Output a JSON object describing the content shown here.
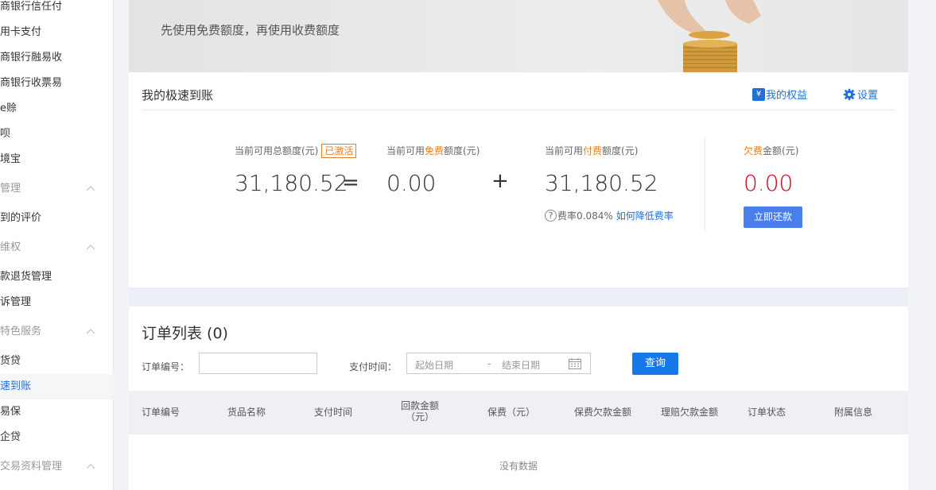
{
  "sidebar": {
    "items": [
      {
        "label": "商银行信任付",
        "type": "item"
      },
      {
        "label": "用卡支付",
        "type": "item"
      },
      {
        "label": "商银行融易收",
        "type": "item"
      },
      {
        "label": "商银行收票易",
        "type": "item"
      },
      {
        "label": "e赊",
        "type": "item"
      },
      {
        "label": "呗",
        "type": "item"
      },
      {
        "label": "境宝",
        "type": "item"
      },
      {
        "label": "管理",
        "type": "group"
      },
      {
        "label": "到的评价",
        "type": "item"
      },
      {
        "label": "维权",
        "type": "group"
      },
      {
        "label": "款退货管理",
        "type": "item"
      },
      {
        "label": "诉管理",
        "type": "item"
      },
      {
        "label": "特色服务",
        "type": "group"
      },
      {
        "label": "货贷",
        "type": "item"
      },
      {
        "label": "速到账",
        "type": "item",
        "active": true
      },
      {
        "label": "易保",
        "type": "item"
      },
      {
        "label": "企贷",
        "type": "item"
      },
      {
        "label": "交易资料管理",
        "type": "group"
      }
    ]
  },
  "banner": {
    "subtitle": "先使用免费额度，再使用收费额度"
  },
  "account": {
    "title": "我的极速到账",
    "benefit_link": "我的权益",
    "benefit_icon": "yen-icon",
    "benefit_icon_glyph": "¥",
    "settings_link": "设置",
    "settings_icon": "gear-icon",
    "total": {
      "label_pre": "当前可用总额度(元)",
      "badge": "已激活",
      "value": "31,180.52",
      "eq": "="
    },
    "free": {
      "label_pre": "当前可用",
      "label_hl": "免费",
      "label_post": "额度(元)",
      "value": "0.00"
    },
    "plus": "+",
    "paid": {
      "label_pre": "当前可用",
      "label_hl": "付费",
      "label_post": "额度(元)",
      "value": "31,180.52"
    },
    "rate": {
      "q": "?",
      "text": "费率0.084%",
      "link": "如何降低费率"
    },
    "debt": {
      "label_hl": "欠费",
      "label_post": "金额(元)",
      "value": "0.00",
      "button": "立即还款"
    }
  },
  "orders": {
    "title": "订单列表 (0)",
    "order_no_label": "订单编号：",
    "pay_time_label": "支付时间：",
    "start_placeholder": "起始日期",
    "sep": "-",
    "end_placeholder": "结束日期",
    "query_button": "查询",
    "columns": [
      [
        "订单编号"
      ],
      [
        "货品名称"
      ],
      [
        "支付时间"
      ],
      [
        "回款金额",
        "（元）"
      ],
      [
        "保费（元）"
      ],
      [
        "保费欠款金额"
      ],
      [
        "理赔欠款金额"
      ],
      [
        "订单状态"
      ],
      [
        "附属信息"
      ]
    ],
    "empty_text": "没有数据"
  },
  "colors": {
    "accent": "#1e6fd9",
    "button": "#1677e8",
    "highlight": "#e67e22",
    "danger": "#d0021b"
  }
}
